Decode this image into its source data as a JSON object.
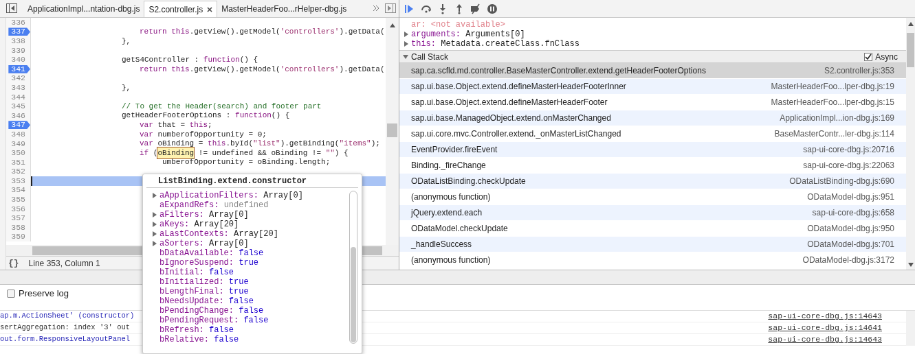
{
  "editor": {
    "tabs": [
      {
        "label": "ApplicationImpl...ntation-dbg.js",
        "selected": false,
        "closable": false
      },
      {
        "label": "S2.controller.js",
        "selected": true,
        "closable": true
      },
      {
        "label": "MasterHeaderFoo...rHelper-dbg.js",
        "selected": false,
        "closable": false
      }
    ],
    "lines": [
      {
        "number": "336",
        "breakpoint": false,
        "current": false
      },
      {
        "number": "337",
        "breakpoint": true,
        "current": false,
        "kind": "inner",
        "tokens": [
          {
            "kind": "keyword",
            "text": "return this"
          },
          {
            "kind": "plain",
            "text": ".getView().getModel("
          },
          {
            "kind": "string",
            "text": "'controllers'"
          },
          {
            "kind": "plain",
            "text": ").getData("
          }
        ]
      },
      {
        "number": "338",
        "breakpoint": false,
        "current": false,
        "kind": "outer",
        "tokens": [
          {
            "kind": "plain",
            "text": "},"
          }
        ]
      },
      {
        "number": "339",
        "breakpoint": false,
        "current": false
      },
      {
        "number": "340",
        "breakpoint": false,
        "current": false,
        "kind": "outer",
        "tokens": [
          {
            "kind": "plain",
            "text": "getS4Controller : "
          },
          {
            "kind": "keyword",
            "text": "function"
          },
          {
            "kind": "plain",
            "text": "() {"
          }
        ]
      },
      {
        "number": "341",
        "breakpoint": true,
        "current": false,
        "kind": "inner",
        "tokens": [
          {
            "kind": "keyword",
            "text": "return this"
          },
          {
            "kind": "plain",
            "text": ".getView().getModel("
          },
          {
            "kind": "string",
            "text": "'controllers'"
          },
          {
            "kind": "plain",
            "text": ").getData("
          }
        ]
      },
      {
        "number": "342",
        "breakpoint": false,
        "current": false
      },
      {
        "number": "343",
        "breakpoint": false,
        "current": false,
        "kind": "outer",
        "tokens": [
          {
            "kind": "plain",
            "text": "},"
          }
        ]
      },
      {
        "number": "344",
        "breakpoint": false,
        "current": false
      },
      {
        "number": "345",
        "breakpoint": false,
        "current": false,
        "kind": "outer",
        "tokens": [
          {
            "kind": "comment",
            "text": "// To get the Header(search) and footer part"
          }
        ]
      },
      {
        "number": "346",
        "breakpoint": false,
        "current": false,
        "kind": "outer",
        "tokens": [
          {
            "kind": "plain",
            "text": "getHeaderFooterOptions : "
          },
          {
            "kind": "keyword",
            "text": "function"
          },
          {
            "kind": "plain",
            "text": "() {"
          }
        ]
      },
      {
        "number": "347",
        "breakpoint": true,
        "current": false,
        "kind": "inner",
        "tokens": [
          {
            "kind": "keyword",
            "text": "var"
          },
          {
            "kind": "plain",
            "text": " that = "
          },
          {
            "kind": "keyword",
            "text": "this"
          },
          {
            "kind": "plain",
            "text": ";"
          }
        ]
      },
      {
        "number": "348",
        "breakpoint": false,
        "current": false,
        "kind": "inner",
        "tokens": [
          {
            "kind": "keyword",
            "text": "var"
          },
          {
            "kind": "plain",
            "text": " numberofOpportunity = 0;"
          }
        ]
      },
      {
        "number": "349",
        "breakpoint": false,
        "current": false,
        "kind": "inner",
        "tokens": [
          {
            "kind": "keyword",
            "text": "var"
          },
          {
            "kind": "plain",
            "text": " oBinding = "
          },
          {
            "kind": "keyword",
            "text": "this"
          },
          {
            "kind": "plain",
            "text": ".byId("
          },
          {
            "kind": "string",
            "text": "\"list\""
          },
          {
            "kind": "plain",
            "text": ").getBinding("
          },
          {
            "kind": "string",
            "text": "\"items\""
          },
          {
            "kind": "plain",
            "text": ");"
          }
        ]
      },
      {
        "number": "350",
        "breakpoint": false,
        "current": false,
        "kind": "inner",
        "tokens": [
          {
            "kind": "keyword",
            "text": "if"
          },
          {
            "kind": "plain",
            "text": " ("
          },
          {
            "kind": "hovered",
            "text": "oBinding"
          },
          {
            "kind": "plain",
            "text": " != undefined && oBinding != "
          },
          {
            "kind": "string",
            "text": "\"\""
          },
          {
            "kind": "plain",
            "text": ") {"
          }
        ]
      },
      {
        "number": "351",
        "breakpoint": false,
        "current": false,
        "kind": "continuation",
        "tokens": [
          {
            "kind": "plain",
            "text": "umberofOpportunity = oBinding.length;"
          }
        ]
      },
      {
        "number": "352",
        "breakpoint": false,
        "current": false
      },
      {
        "number": "353",
        "breakpoint": false,
        "current": true
      },
      {
        "number": "354",
        "breakpoint": false,
        "current": false
      },
      {
        "number": "355",
        "breakpoint": false,
        "current": false
      },
      {
        "number": "356",
        "breakpoint": false,
        "current": false
      },
      {
        "number": "357",
        "breakpoint": false,
        "current": false
      },
      {
        "number": "358",
        "breakpoint": false,
        "current": false
      },
      {
        "number": "359",
        "breakpoint": false,
        "current": false
      }
    ],
    "pretty_print": "{}",
    "status": "Line 353, Column 1"
  },
  "popover": {
    "title": "ListBinding.extend.constructor",
    "properties": [
      {
        "name": "aApplicationFilters:",
        "value": "Array[0]",
        "kind": "object",
        "expandable": true
      },
      {
        "name": "aExpandRefs:",
        "value": "undefined",
        "kind": "undefined",
        "expandable": false
      },
      {
        "name": "aFilters:",
        "value": "Array[0]",
        "kind": "object",
        "expandable": true
      },
      {
        "name": "aKeys:",
        "value": "Array[20]",
        "kind": "object",
        "expandable": true
      },
      {
        "name": "aLastContexts:",
        "value": "Array[20]",
        "kind": "object",
        "expandable": true
      },
      {
        "name": "aSorters:",
        "value": "Array[0]",
        "kind": "object",
        "expandable": true
      },
      {
        "name": "bDataAvailable:",
        "value": "false",
        "kind": "boolean",
        "expandable": false
      },
      {
        "name": "bIgnoreSuspend:",
        "value": "true",
        "kind": "boolean",
        "expandable": false
      },
      {
        "name": "bInitial:",
        "value": "false",
        "kind": "boolean",
        "expandable": false
      },
      {
        "name": "bInitialized:",
        "value": "true",
        "kind": "boolean",
        "expandable": false
      },
      {
        "name": "bLengthFinal:",
        "value": "true",
        "kind": "boolean",
        "expandable": false
      },
      {
        "name": "bNeedsUpdate:",
        "value": "false",
        "kind": "boolean",
        "expandable": false
      },
      {
        "name": "bPendingChange:",
        "value": "false",
        "kind": "boolean",
        "expandable": false
      },
      {
        "name": "bPendingRequest:",
        "value": "false",
        "kind": "boolean",
        "expandable": false
      },
      {
        "name": "bRefresh:",
        "value": "false",
        "kind": "boolean",
        "expandable": false
      },
      {
        "name": "bRelative:",
        "value": "false",
        "kind": "boolean",
        "expandable": false
      }
    ]
  },
  "scope": [
    {
      "name": "ar:",
      "value": "<not available>",
      "kind": "unavailable",
      "expandable": false
    },
    {
      "name": "arguments:",
      "value": "Arguments[0]",
      "kind": "object",
      "expandable": true
    },
    {
      "name": "this:",
      "value": "Metadata.createClass.fnClass",
      "kind": "object",
      "expandable": true
    }
  ],
  "call_stack": {
    "title": "Call Stack",
    "expanded": true,
    "async": {
      "label": "Async",
      "checked": true
    },
    "frames": [
      {
        "function": "sap.ca.scfld.md.controller.BaseMasterController.extend.getHeaderFooterOptions",
        "location": "S2.controller.js:353",
        "selected": true
      },
      {
        "function": "sap.ui.base.Object.extend.defineMasterHeaderFooterInner",
        "location": "MasterHeaderFoo...lper-dbg.js:19",
        "selected": false
      },
      {
        "function": "sap.ui.base.Object.extend.defineMasterHeaderFooter",
        "location": "MasterHeaderFoo...lper-dbg.js:15",
        "selected": false
      },
      {
        "function": "sap.ui.base.ManagedObject.extend.onMasterChanged",
        "location": "ApplicationImpl...ion-dbg.js:169",
        "selected": false
      },
      {
        "function": "sap.ui.core.mvc.Controller.extend._onMasterListChanged",
        "location": "BaseMasterContr...ler-dbg.js:114",
        "selected": false
      },
      {
        "function": "EventProvider.fireEvent",
        "location": "sap-ui-core-dbg.js:20716",
        "selected": false
      },
      {
        "function": "Binding._fireChange",
        "location": "sap-ui-core-dbg.js:22063",
        "selected": false
      },
      {
        "function": "ODataListBinding.checkUpdate",
        "location": "ODataListBinding-dbg.js:690",
        "selected": false
      },
      {
        "function": "(anonymous function)",
        "location": "ODataModel-dbg.js:951",
        "selected": false
      },
      {
        "function": "jQuery.extend.each",
        "location": "sap-ui-core-dbg.js:658",
        "selected": false
      },
      {
        "function": "ODataModel.checkUpdate",
        "location": "ODataModel-dbg.js:950",
        "selected": false
      },
      {
        "function": "_handleSuccess",
        "location": "ODataModel-dbg.js:701",
        "selected": false
      },
      {
        "function": "(anonymous function)",
        "location": "ODataModel-dbg.js:3172",
        "selected": false
      }
    ]
  },
  "console": {
    "preserve_log": {
      "label": "Preserve log",
      "checked": false
    },
    "messages": [
      {
        "text": "ap.m.ActionSheet' (constructor)",
        "color": "#2a2ab8",
        "source": "sap-ui-core-dbg.js:14643"
      },
      {
        "text": "sertAggregation: index '3' out",
        "color": "#303030",
        "source": "sap-ui-core-dbg.js:14641"
      },
      {
        "text": "out.form.ResponsiveLayoutPanel",
        "color": "#2a2ab8",
        "source": "sap-ui-core-dbg.js:14643"
      }
    ]
  }
}
